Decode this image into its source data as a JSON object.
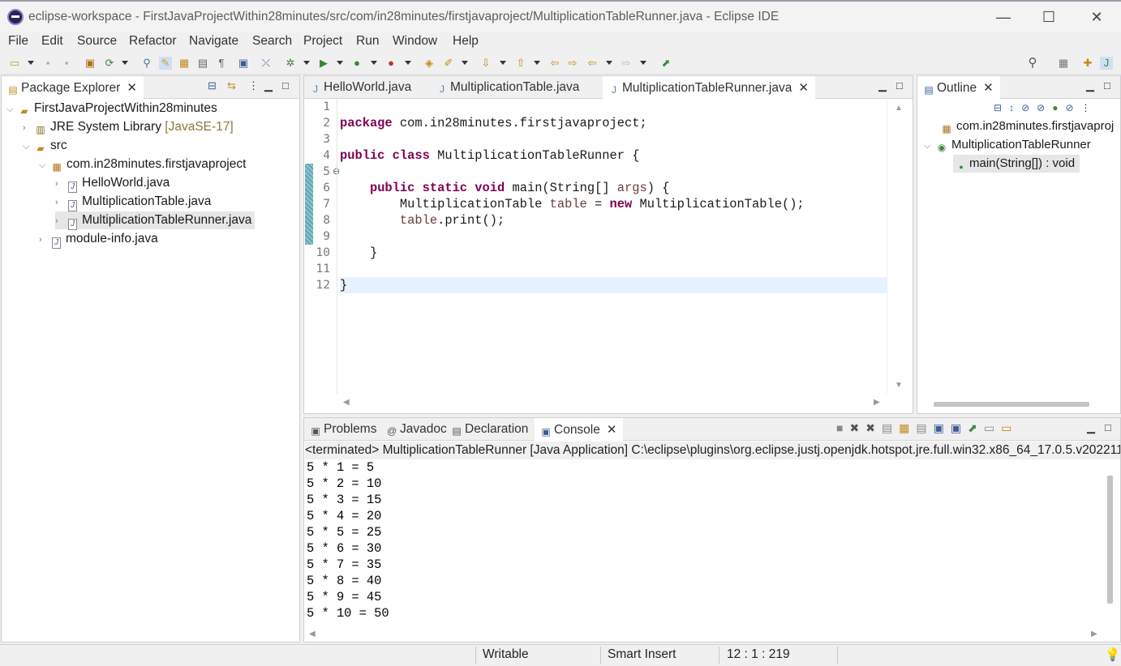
{
  "window": {
    "title": "eclipse-workspace - FirstJavaProjectWithin28minutes/src/com/in28minutes/firstjavaproject/MultiplicationTableRunner.java - Eclipse IDE",
    "minimize": "—",
    "maximize": "☐",
    "close": "✕"
  },
  "menu": [
    "File",
    "Edit",
    "Source",
    "Refactor",
    "Navigate",
    "Search",
    "Project",
    "Run",
    "Window",
    "Help"
  ],
  "package_explorer": {
    "tab_label": "Package Explorer",
    "tree": [
      {
        "label": "FirstJavaProjectWithin28minutes",
        "depth": 0,
        "expanded": true,
        "icon": "project-icon"
      },
      {
        "label": "JRE System Library",
        "suffix": "[JavaSE-17]",
        "depth": 1,
        "expanded": false,
        "icon": "library-icon"
      },
      {
        "label": "src",
        "depth": 1,
        "expanded": true,
        "icon": "source-folder-icon"
      },
      {
        "label": "com.in28minutes.firstjavaproject",
        "depth": 2,
        "expanded": true,
        "icon": "package-icon"
      },
      {
        "label": "HelloWorld.java",
        "depth": 3,
        "expanded": false,
        "icon": "java-file-icon"
      },
      {
        "label": "MultiplicationTable.java",
        "depth": 3,
        "expanded": false,
        "icon": "java-file-icon"
      },
      {
        "label": "MultiplicationTableRunner.java",
        "depth": 3,
        "expanded": false,
        "icon": "java-file-icon",
        "selected": true
      },
      {
        "label": "module-info.java",
        "depth": 2,
        "expanded": false,
        "icon": "java-file-icon"
      }
    ]
  },
  "editor": {
    "tabs": [
      {
        "label": "HelloWorld.java",
        "active": false
      },
      {
        "label": "MultiplicationTable.java",
        "active": false
      },
      {
        "label": "MultiplicationTableRunner.java",
        "active": true
      }
    ],
    "lines": [
      "package com.in28minutes.firstjavaproject;",
      "",
      "public class MultiplicationTableRunner {",
      "",
      "    public static void main(String[] args) {",
      "        MultiplicationTable table = new MultiplicationTable();",
      "        table.print();",
      "",
      "    }",
      "",
      "}",
      ""
    ],
    "current_line": 12
  },
  "outline": {
    "tab_label": "Outline",
    "items": [
      {
        "label": "com.in28minutes.firstjavaproj",
        "icon": "package-icon"
      },
      {
        "label": "MultiplicationTableRunner",
        "icon": "class-icon"
      },
      {
        "label": "main(String[]) : void",
        "icon": "method-icon"
      }
    ]
  },
  "bottom": {
    "tabs": [
      {
        "label": "Problems",
        "icon": "problems-icon"
      },
      {
        "label": "Javadoc",
        "icon": "javadoc-icon"
      },
      {
        "label": "Declaration",
        "icon": "declaration-icon"
      },
      {
        "label": "Console",
        "icon": "console-icon",
        "active": true
      }
    ],
    "console_header": "<terminated> MultiplicationTableRunner [Java Application] C:\\eclipse\\plugins\\org.eclipse.justj.openjdk.hotspot.jre.full.win32.x86_64_17.0.5.v202211",
    "output": [
      "5 * 1 = 5",
      "5 * 2 = 10",
      "5 * 3 = 15",
      "5 * 4 = 20",
      "5 * 5 = 25",
      "5 * 6 = 30",
      "5 * 7 = 35",
      "5 * 8 = 40",
      "5 * 9 = 45",
      "5 * 10 = 50"
    ]
  },
  "status": {
    "writable": "Writable",
    "insert_mode": "Smart Insert",
    "position": "12 : 1 : 219"
  }
}
